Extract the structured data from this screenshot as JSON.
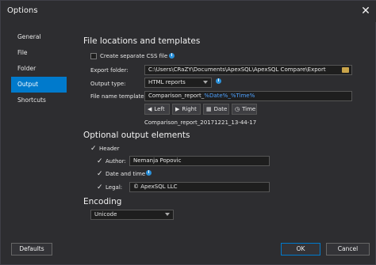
{
  "window": {
    "title": "Options",
    "close_glyph": "✕"
  },
  "nav": {
    "items": [
      {
        "label": "General",
        "active": false
      },
      {
        "label": "File",
        "active": false
      },
      {
        "label": "Folder",
        "active": false
      },
      {
        "label": "Output",
        "active": true
      },
      {
        "label": "Shortcuts",
        "active": false
      }
    ]
  },
  "file_locations": {
    "heading": "File locations and templates",
    "create_css_label": "Create separate CSS file",
    "create_css_checked": false,
    "export_folder_label": "Export folder:",
    "export_folder_value": "C:\\Users\\CRaZY\\Documents\\ApexSQL\\ApexSQL Compare\\Export",
    "output_type_label": "Output type:",
    "output_type_value": "HTML reports",
    "file_name_template_label": "File name template:",
    "template_prefix": "Comparison_report_",
    "template_tokens": "%Date%_%Time%",
    "buttons": {
      "left": "Left",
      "right": "Right",
      "date": "Date",
      "time": "Time"
    },
    "preview": "Comparison_report_20171221_13-44-17"
  },
  "optional": {
    "heading": "Optional output elements",
    "header_label": "Header",
    "header_checked": true,
    "author_label": "Author:",
    "author_checked": true,
    "author_value": "Nemanja Popovic",
    "date_time_label": "Date and time",
    "date_time_checked": true,
    "legal_label": "Legal:",
    "legal_checked": true,
    "legal_value": "© ApexSQL LLC"
  },
  "encoding": {
    "heading": "Encoding",
    "value": "Unicode"
  },
  "footer": {
    "defaults": "Defaults",
    "ok": "OK",
    "cancel": "Cancel"
  },
  "colors": {
    "accent": "#007acc",
    "background": "#2d2d30",
    "input_bg": "#1e1e1e",
    "info": "#2b90d9",
    "token": "#4ea1ff"
  },
  "icons": {
    "info": "info-icon",
    "folder": "folder-icon",
    "left": "arrow-left-icon",
    "right": "arrow-right-icon",
    "date": "calendar-icon",
    "time": "clock-icon",
    "check": "checkmark-icon"
  }
}
